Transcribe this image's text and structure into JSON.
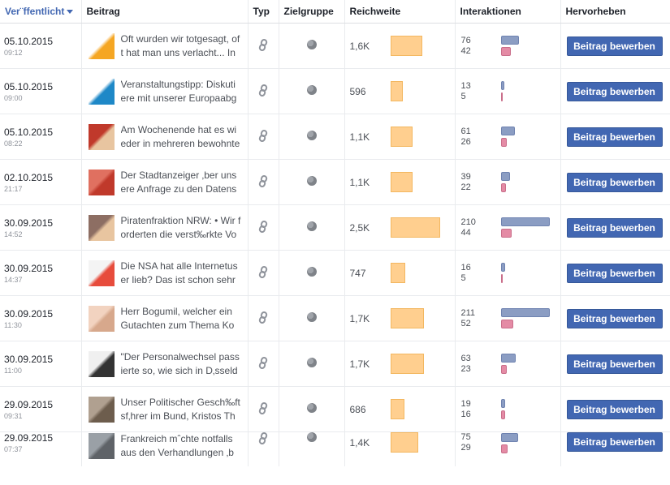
{
  "columns": {
    "published": "Ver¨ffentlicht",
    "post": "Beitrag",
    "type": "Typ",
    "audience": "Zielgruppe",
    "reach": "Reichweite",
    "interactions": "Interaktionen",
    "promote": "Hervorheben"
  },
  "colors": {
    "accent": "#4267b2",
    "reach_bar": "#ffcf8f",
    "clicks_bar": "#8b9dc3",
    "reactions_bar": "#e48ba5"
  },
  "reach_scale_max": 2.5,
  "interaction_scale_max": 211,
  "rows": [
    {
      "date": "05.10.2015",
      "time": "09:12",
      "text": "Oft wurden wir totgesagt, oft hat man uns verlacht... In",
      "type_icon": "link-icon",
      "audience_icon": "globe-icon",
      "reach": "1,6K",
      "reach_value": 1.6,
      "int1": "76",
      "int2": "42",
      "int1_value": 76,
      "int2_value": 42,
      "button": "Beitrag bewerben",
      "thumb": [
        "#ffffff",
        "#f5a623"
      ]
    },
    {
      "date": "05.10.2015",
      "time": "09:00",
      "text": "Veranstaltungstipp: Diskutiere mit unserer Europaabg",
      "type_icon": "link-icon",
      "audience_icon": "globe-icon",
      "reach": "596",
      "reach_value": 0.596,
      "int1": "13",
      "int2": "5",
      "int1_value": 13,
      "int2_value": 5,
      "button": "Beitrag bewerben",
      "thumb": [
        "#ffffff",
        "#1e88c7"
      ]
    },
    {
      "date": "05.10.2015",
      "time": "08:22",
      "text": "Am Wochenende hat es wieder in mehreren bewohnte",
      "type_icon": "link-icon",
      "audience_icon": "globe-icon",
      "reach": "1,1K",
      "reach_value": 1.1,
      "int1": "61",
      "int2": "26",
      "int1_value": 61,
      "int2_value": 26,
      "button": "Beitrag bewerben",
      "thumb": [
        "#c0392b",
        "#e8c5a0"
      ]
    },
    {
      "date": "02.10.2015",
      "time": "21:17",
      "text": "Der Stadtanzeiger ‚ber unsere Anfrage zu den Datens",
      "type_icon": "link-icon",
      "audience_icon": "globe-icon",
      "reach": "1,1K",
      "reach_value": 1.1,
      "int1": "39",
      "int2": "22",
      "int1_value": 39,
      "int2_value": 22,
      "button": "Beitrag bewerben",
      "thumb": [
        "#e07060",
        "#c0392b"
      ]
    },
    {
      "date": "30.09.2015",
      "time": "14:52",
      "text": "Piratenfraktion NRW: • Wir forderten die verst‰rkte Vo",
      "type_icon": "link-icon",
      "audience_icon": "globe-icon",
      "reach": "2,5K",
      "reach_value": 2.5,
      "int1": "210",
      "int2": "44",
      "int1_value": 210,
      "int2_value": 44,
      "button": "Beitrag bewerben",
      "thumb": [
        "#8d6e63",
        "#e8c5a0"
      ]
    },
    {
      "date": "30.09.2015",
      "time": "14:37",
      "text": "Die NSA hat alle Internetuser lieb? Das ist schon sehr",
      "type_icon": "link-icon",
      "audience_icon": "globe-icon",
      "reach": "747",
      "reach_value": 0.747,
      "int1": "16",
      "int2": "5",
      "int1_value": 16,
      "int2_value": 5,
      "button": "Beitrag bewerben",
      "thumb": [
        "#f4f4f4",
        "#e74c3c"
      ]
    },
    {
      "date": "30.09.2015",
      "time": "11:30",
      "text": "Herr Bogumil, welcher ein Gutachten zum Thema Ko",
      "type_icon": "link-icon",
      "audience_icon": "globe-icon",
      "reach": "1,7K",
      "reach_value": 1.7,
      "int1": "211",
      "int2": "52",
      "int1_value": 211,
      "int2_value": 52,
      "button": "Beitrag bewerben",
      "thumb": [
        "#f2d3c0",
        "#d7a88c"
      ]
    },
    {
      "date": "30.09.2015",
      "time": "11:00",
      "text": "\"Der Personalwechsel passierte so, wie sich in D‚sseld",
      "type_icon": "link-icon",
      "audience_icon": "globe-icon",
      "reach": "1,7K",
      "reach_value": 1.7,
      "int1": "63",
      "int2": "23",
      "int1_value": 63,
      "int2_value": 23,
      "button": "Beitrag bewerben",
      "thumb": [
        "#f0f0f0",
        "#333333"
      ]
    },
    {
      "date": "29.09.2015",
      "time": "09:31",
      "text": "Unser Politischer Gesch‰ftsf‚hrer im Bund, Kristos Th",
      "type_icon": "link-icon",
      "audience_icon": "globe-icon",
      "reach": "686",
      "reach_value": 0.686,
      "int1": "19",
      "int2": "16",
      "int1_value": 19,
      "int2_value": 16,
      "button": "Beitrag bewerben",
      "thumb": [
        "#b0a090",
        "#6d5d4d"
      ]
    },
    {
      "date": "29.09.2015",
      "time": "07:37",
      "text": "Frankreich mˆchte notfalls aus den Verhandlungen ‚b",
      "type_icon": "link-icon",
      "audience_icon": "globe-icon",
      "reach": "1,4K",
      "reach_value": 1.4,
      "int1": "75",
      "int2": "29",
      "int1_value": 75,
      "int2_value": 29,
      "button": "Beitrag bewerben",
      "thumb": [
        "#9aa0a6",
        "#5f6368"
      ]
    }
  ]
}
